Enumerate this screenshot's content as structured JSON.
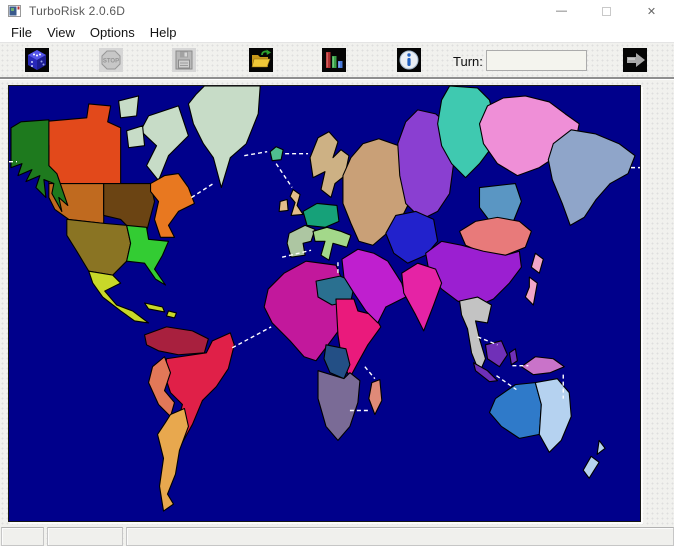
{
  "window": {
    "title": "TurboRisk 2.0.6D",
    "controls": {
      "minimize": "—",
      "close": "✕"
    }
  },
  "menu": {
    "items": {
      "file": "File",
      "view": "View",
      "options": "Options",
      "help": "Help"
    }
  },
  "toolbar": {
    "turn_label": "Turn:",
    "turn_value": "",
    "stop_text": "STOP",
    "icons": [
      {
        "name": "dice",
        "enabled": true
      },
      {
        "name": "stop",
        "enabled": false
      },
      {
        "name": "save",
        "enabled": false
      },
      {
        "name": "open-folder",
        "enabled": true
      },
      {
        "name": "statistics",
        "enabled": true
      },
      {
        "name": "info",
        "enabled": true
      },
      {
        "name": "next-turn",
        "enabled": false
      }
    ]
  },
  "status_bar": {
    "panels": [
      "",
      "",
      ""
    ]
  },
  "map": {
    "sea": "#00008B",
    "territories": {
      "alaska": "#1E7A1E",
      "northwest-territory": "#E2491B",
      "arctic-islands": "#C7DCC7",
      "greenland": "#C7DCC7",
      "alberta": "#C06A1F",
      "ontario": "#6B4413",
      "quebec": "#E87820",
      "western-us": "#8A7423",
      "eastern-us": "#33CC33",
      "central-america": "#C8D829",
      "venezuela": "#A8203E",
      "peru": "#E27858",
      "brazil": "#E02048",
      "argentina": "#E8A84E",
      "iceland": "#4FBF8F",
      "great-britain": "#E3BD8A",
      "ireland": "#E3BD8A",
      "scandinavia": "#CDB184",
      "ukraine": "#C9A077",
      "northern-europe": "#16A179",
      "western-europe": "#ADC6A2",
      "southern-europe": "#A3D88A",
      "north-africa": "#C2189C",
      "egypt": "#2A7090",
      "east-africa": "#EA1A7C",
      "congo": "#234F85",
      "south-africa": "#7A6B96",
      "madagascar": "#DF8A78",
      "middle-east": "#BF1FCF",
      "afghanistan": "#2222CC",
      "ural": "#8A3FD1",
      "siberia": "#3FC9B0",
      "yakutsk": "#EF8FD7",
      "kamchatka": "#8FA5C9",
      "irkutsk": "#5A96C3",
      "mongolia": "#E87A7A",
      "japan": "#F2A5C9",
      "china": "#9B1FD1",
      "india": "#E523A5",
      "siam": "#C3C3C3",
      "indonesia": "#7030B8",
      "new-guinea": "#C973C9",
      "western-australia": "#2F7AC9",
      "eastern-australia": "#B5D2F0",
      "new-zealand": "#B5D2F0"
    }
  }
}
